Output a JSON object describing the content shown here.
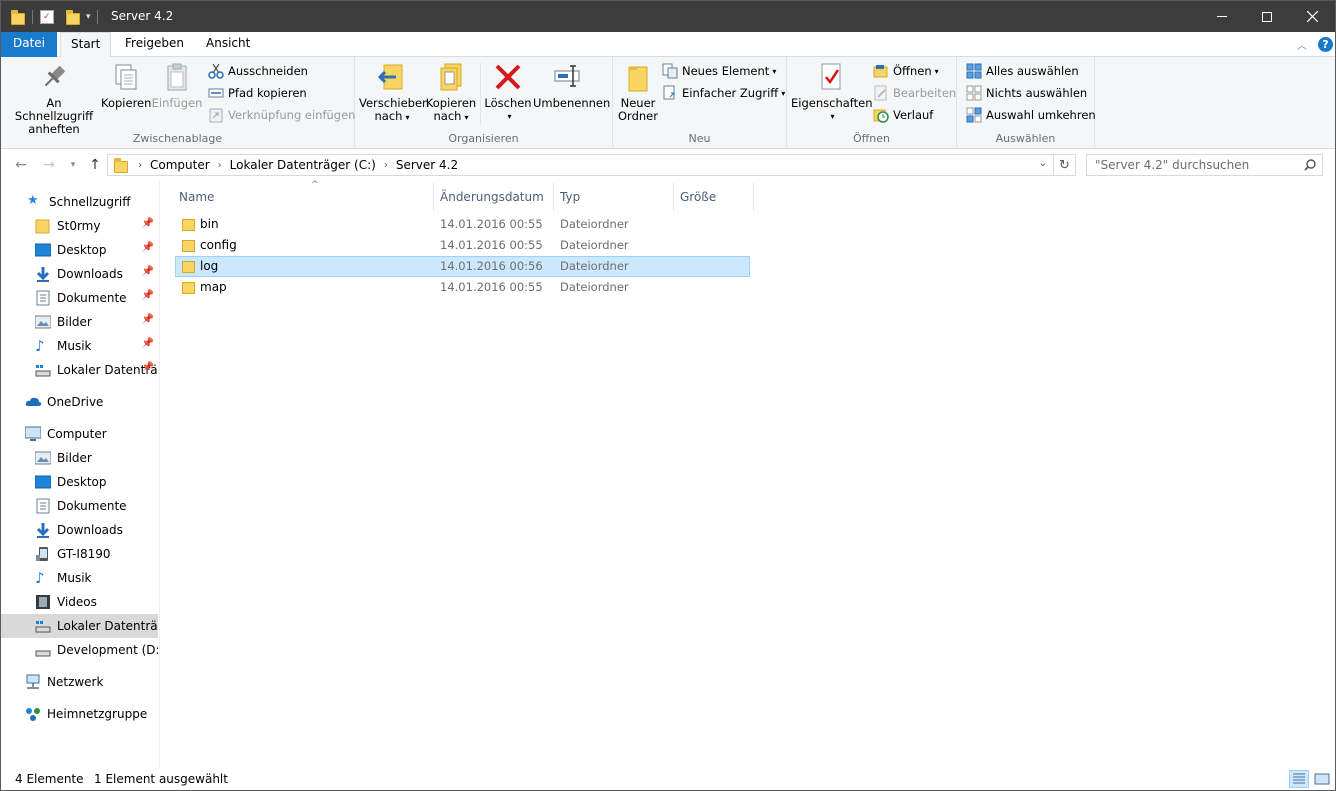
{
  "window": {
    "title": "Server 4.2"
  },
  "ribbon_tabs": {
    "file": "Datei",
    "start": "Start",
    "share": "Freigeben",
    "view": "Ansicht"
  },
  "ribbon": {
    "clipboard": {
      "label": "Zwischenablage",
      "pin_line1": "An Schnellzugriff",
      "pin_line2": "anheften",
      "copy": "Kopieren",
      "paste": "Einfügen",
      "cut": "Ausschneiden",
      "copy_path": "Pfad kopieren",
      "paste_shortcut": "Verknüpfung einfügen"
    },
    "organize": {
      "label": "Organisieren",
      "move_line1": "Verschieben",
      "move_line2": "nach",
      "copyto_line1": "Kopieren",
      "copyto_line2": "nach",
      "delete": "Löschen",
      "rename": "Umbenennen"
    },
    "new": {
      "label": "Neu",
      "new_folder_line1": "Neuer",
      "new_folder_line2": "Ordner",
      "new_item": "Neues Element",
      "easy_access": "Einfacher Zugriff"
    },
    "open": {
      "label": "Öffnen",
      "properties": "Eigenschaften",
      "open": "Öffnen",
      "edit": "Bearbeiten",
      "history": "Verlauf"
    },
    "select": {
      "label": "Auswählen",
      "select_all": "Alles auswählen",
      "select_none": "Nichts auswählen",
      "invert": "Auswahl umkehren"
    }
  },
  "address": {
    "crumbs": [
      "Computer",
      "Lokaler Datenträger (C:)",
      "Server 4.2"
    ],
    "search_placeholder": "\"Server 4.2\" durchsuchen"
  },
  "sidebar": {
    "quick_access": "Schnellzugriff",
    "quick_items": [
      "St0rmy",
      "Desktop",
      "Downloads",
      "Dokumente",
      "Bilder",
      "Musik",
      "Lokaler Datenträ"
    ],
    "onedrive": "OneDrive",
    "computer": "Computer",
    "computer_items": [
      "Bilder",
      "Desktop",
      "Dokumente",
      "Downloads",
      "GT-I8190",
      "Musik",
      "Videos",
      "Lokaler Datenträger",
      "Development (D:)"
    ],
    "network": "Netzwerk",
    "homegroup": "Heimnetzgruppe"
  },
  "columns": {
    "name": "Name",
    "date": "Änderungsdatum",
    "type": "Typ",
    "size": "Größe"
  },
  "files": [
    {
      "name": "bin",
      "date": "14.01.2016 00:55",
      "type": "Dateiordner"
    },
    {
      "name": "config",
      "date": "14.01.2016 00:55",
      "type": "Dateiordner"
    },
    {
      "name": "log",
      "date": "14.01.2016 00:56",
      "type": "Dateiordner"
    },
    {
      "name": "map",
      "date": "14.01.2016 00:55",
      "type": "Dateiordner"
    }
  ],
  "status": {
    "count": "4 Elemente",
    "selected": "1 Element ausgewählt"
  },
  "colors": {
    "file_tab": "#1979ca",
    "selection": "#cce8ff",
    "title_bar": "#3c3c3c"
  }
}
